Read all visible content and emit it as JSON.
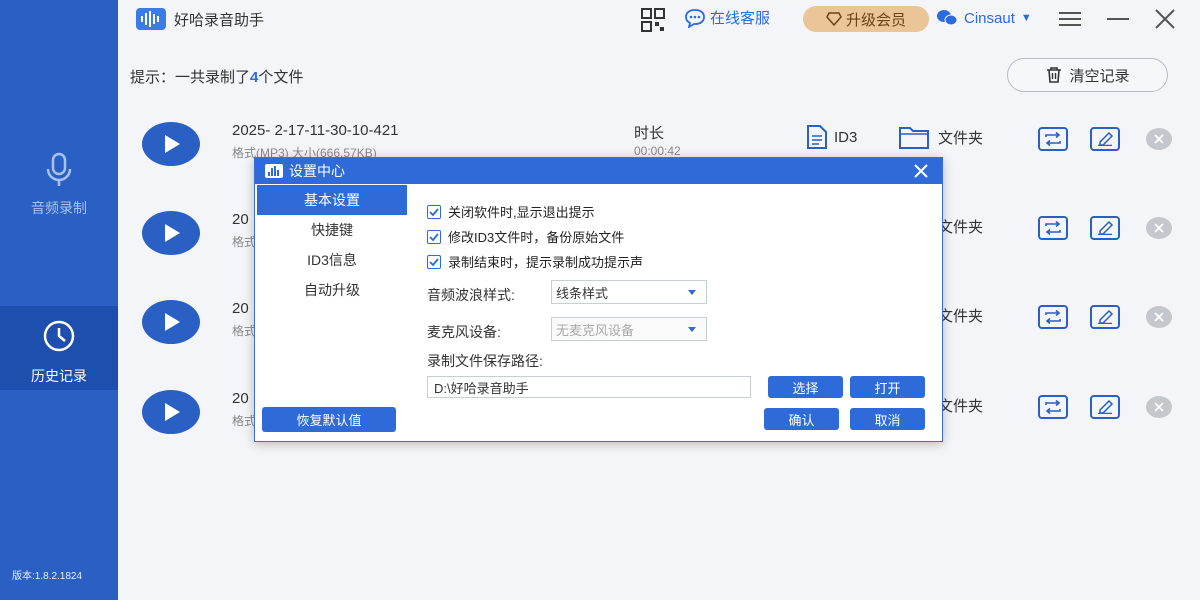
{
  "app": {
    "title": "好哈录音助手",
    "version": "版本:1.8.2.1824"
  },
  "sidebar": {
    "items": [
      {
        "label": "音频录制",
        "icon": "microphone-icon"
      },
      {
        "label": "历史记录",
        "icon": "clock-icon"
      }
    ]
  },
  "topbar": {
    "service_label": "在线客服",
    "vip_label": "升级会员",
    "username": "Cinsaut"
  },
  "content": {
    "hint_prefix": "提示：一共录制了",
    "hint_count": "4",
    "hint_suffix": "个文件",
    "clear_label": "清空记录"
  },
  "records": [
    {
      "name": "2025- 2-17-11-30-10-421",
      "format": "格式(MP3) 大小(666.57KB)",
      "duration_label": "时长",
      "duration": "00:00:42",
      "id3": "ID3",
      "folder": "文件夹"
    },
    {
      "name": "20",
      "format": "格式",
      "duration_label": "",
      "duration": "",
      "id3": "",
      "folder": "文件夹"
    },
    {
      "name": "20",
      "format": "格式",
      "duration_label": "",
      "duration": "",
      "id3": "",
      "folder": "文件夹"
    },
    {
      "name": "20",
      "format": "格式",
      "duration_label": "",
      "duration": "",
      "id3": "",
      "folder": "文件夹"
    }
  ],
  "dialog": {
    "title": "设置中心",
    "nav": [
      "基本设置",
      "快捷键",
      "ID3信息",
      "自动升级"
    ],
    "options": [
      {
        "label": "关闭软件时,显示退出提示",
        "checked": true
      },
      {
        "label": "修改ID3文件时，备份原始文件",
        "checked": true
      },
      {
        "label": "录制结束时，提示录制成功提示声",
        "checked": true
      }
    ],
    "wave_label": "音频波浪样式:",
    "wave_value": "线条样式",
    "mic_label": "麦克风设备:",
    "mic_value": "无麦克风设备",
    "path_label": "录制文件保存路径:",
    "path_value": "D:\\好哈录音助手",
    "choose_label": "选择",
    "open_label": "打开",
    "reset_label": "恢复默认值",
    "ok_label": "确认",
    "cancel_label": "取消"
  }
}
